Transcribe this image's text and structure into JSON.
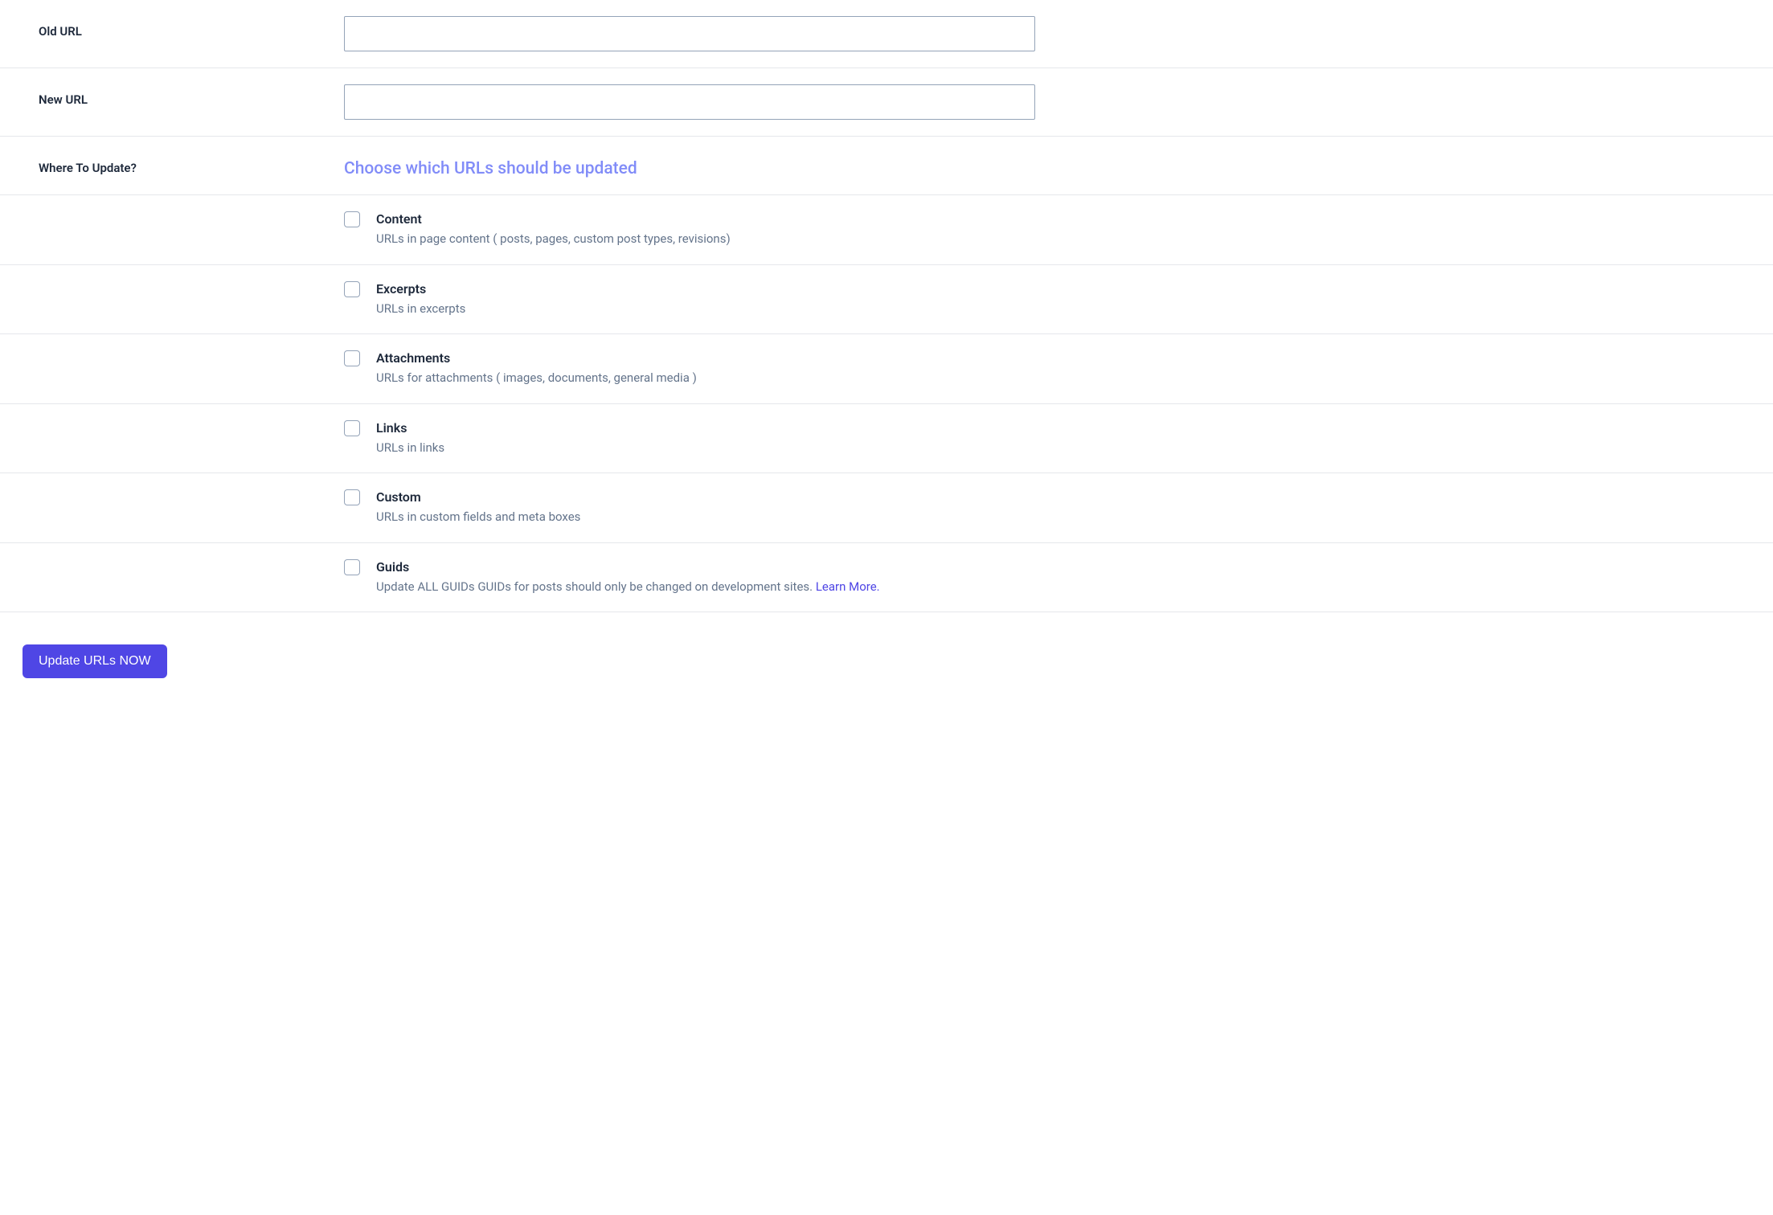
{
  "fields": {
    "old_url": {
      "label": "Old URL",
      "value": ""
    },
    "new_url": {
      "label": "New URL",
      "value": ""
    }
  },
  "where_section": {
    "label": "Where To Update?",
    "heading": "Choose which URLs should be updated"
  },
  "options": [
    {
      "name": "content",
      "title": "Content",
      "desc": "URLs in page content ( posts, pages, custom post types, revisions)",
      "checked": false
    },
    {
      "name": "excerpts",
      "title": "Excerpts",
      "desc": "URLs in excerpts",
      "checked": false
    },
    {
      "name": "attachments",
      "title": "Attachments",
      "desc": "URLs for attachments ( images, documents, general media )",
      "checked": false
    },
    {
      "name": "links",
      "title": "Links",
      "desc": "URLs in links",
      "checked": false
    },
    {
      "name": "custom",
      "title": "Custom",
      "desc": "URLs in custom fields and meta boxes",
      "checked": false
    },
    {
      "name": "guids",
      "title": "Guids",
      "desc": "Update ALL GUIDs GUIDs for posts should only be changed on development sites. ",
      "link_text": "Learn More.",
      "checked": false
    }
  ],
  "submit_button": "Update URLs NOW"
}
